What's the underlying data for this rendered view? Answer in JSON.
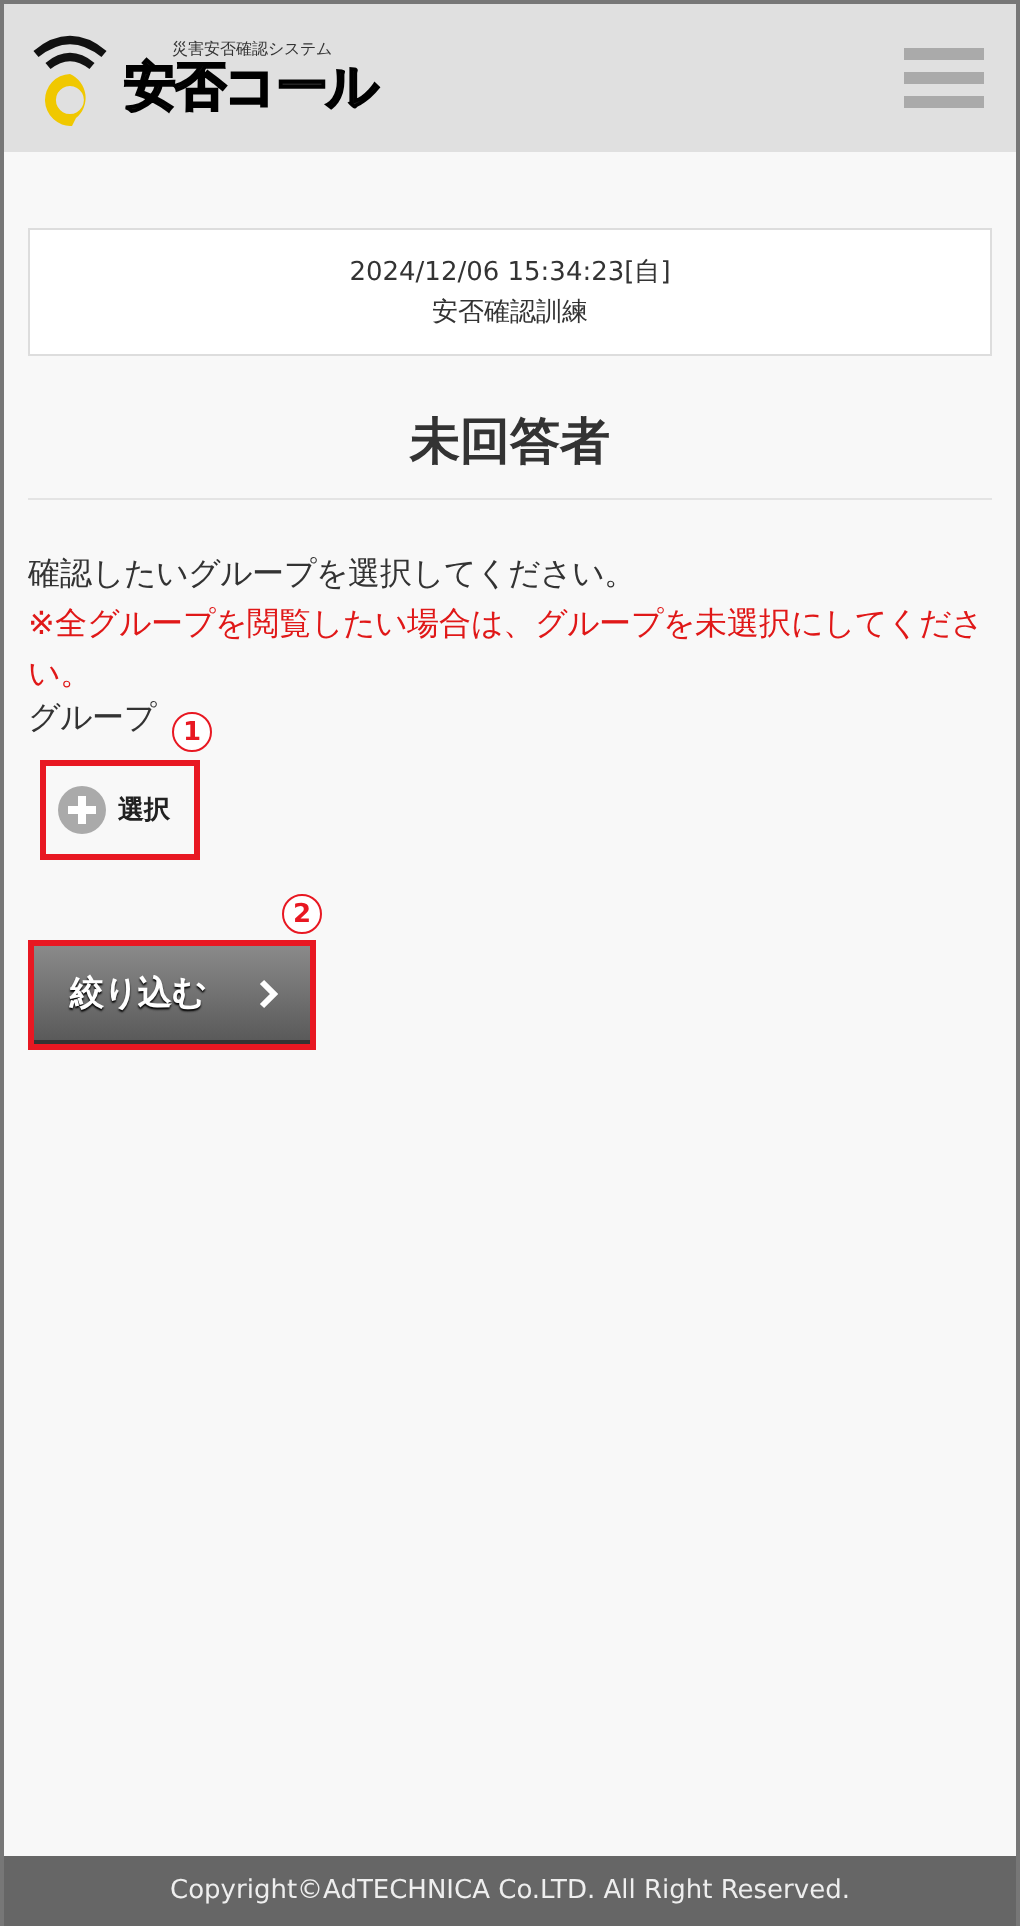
{
  "header": {
    "logo_subtitle": "災害安否確認システム",
    "logo_title": "安否コール"
  },
  "notice": {
    "datetime": "2024/12/06 15:34:23[自]",
    "title": "安否確認訓練"
  },
  "page_title": "未回答者",
  "instruction": "確認したいグループを選択してください。",
  "warning": "※全グループを閲覧したい場合は、グループを未選択にしてください。",
  "group": {
    "label": "グループ",
    "select_button": "選択",
    "callout": "1"
  },
  "filter": {
    "button": "絞り込む",
    "callout": "2"
  },
  "footer": "Copyright©AdTECHNICA Co.LTD. All Right Reserved."
}
